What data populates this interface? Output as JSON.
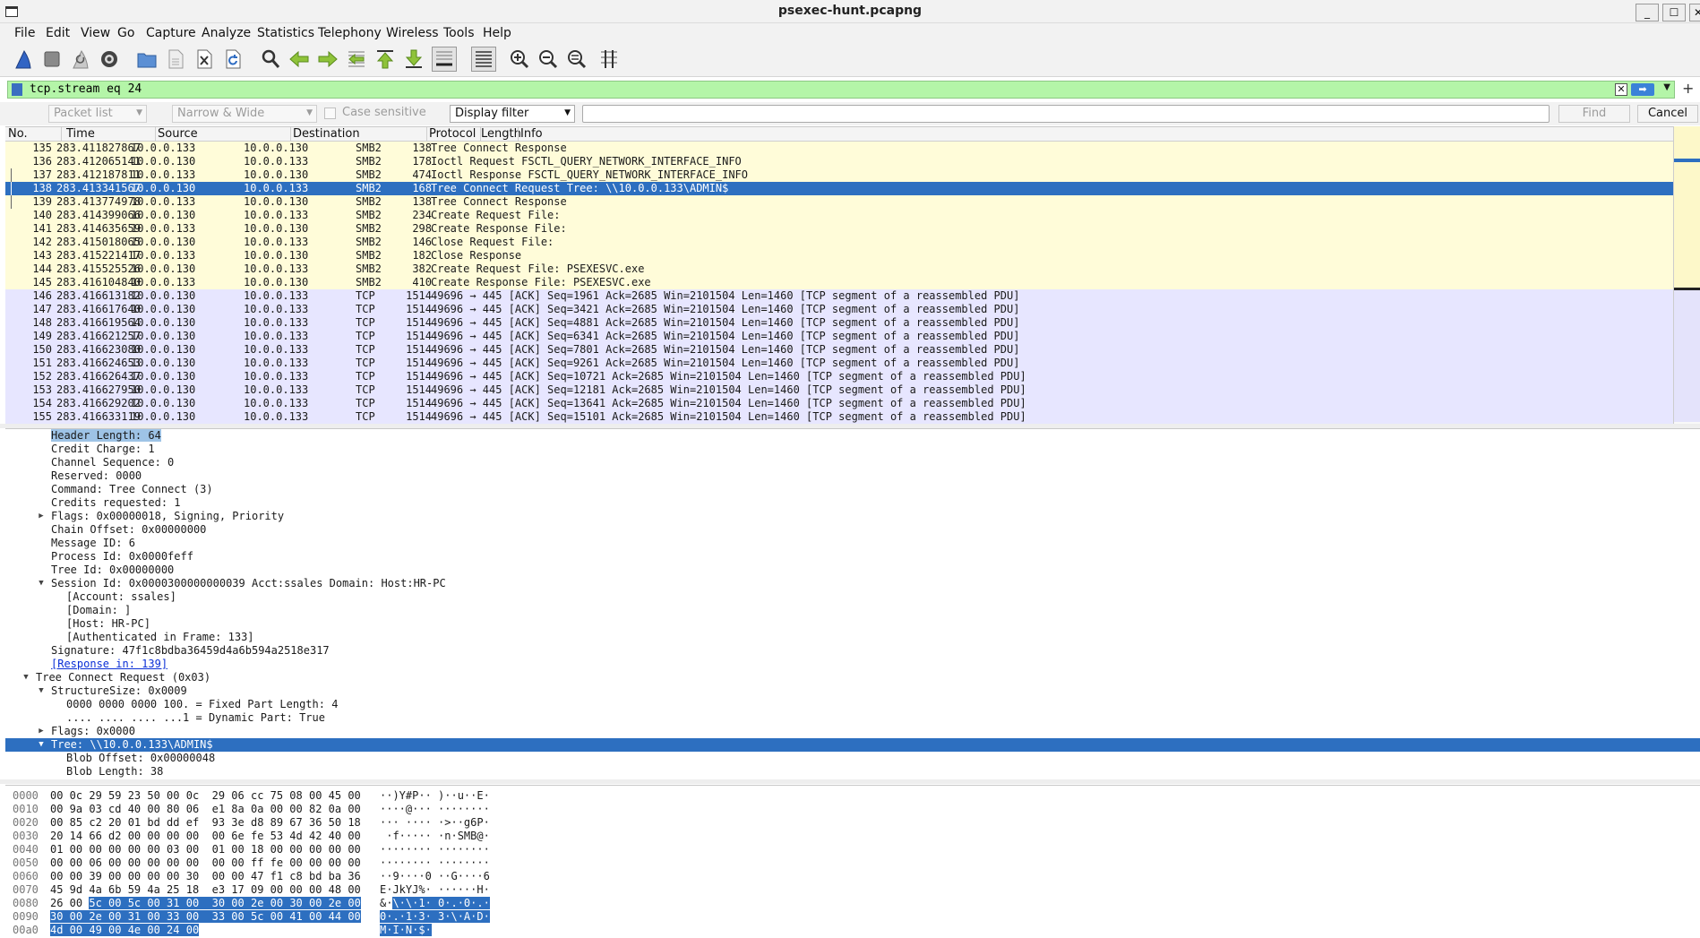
{
  "window": {
    "title": "psexec-hunt.pcapng"
  },
  "menu": [
    "File",
    "Edit",
    "View",
    "Go",
    "Capture",
    "Analyze",
    "Statistics",
    "Telephony",
    "Wireless",
    "Tools",
    "Help"
  ],
  "toolbar_icons": [
    "shark-fin-start-icon",
    "stop-square-icon",
    "restart-fin-icon",
    "capture-options-gear-icon",
    "open-folder-icon",
    "save-file-icon",
    "close-file-icon",
    "reload-icon",
    "find-packet-icon",
    "go-back-icon",
    "go-forward-icon",
    "go-to-packet-icon",
    "first-packet-icon",
    "last-packet-icon",
    "autoscroll-icon",
    "colorize-icon",
    "zoom-in-icon",
    "zoom-out-icon",
    "zoom-normal-icon",
    "resize-columns-icon"
  ],
  "filter": {
    "value": "tcp.stream eq 24",
    "color": "#b4f5a8"
  },
  "findbar": {
    "search_in": "Packet list",
    "char_width": "Narrow & Wide",
    "case_label": "Case sensitive",
    "search_type": "Display filter",
    "find_label": "Find",
    "cancel_label": "Cancel"
  },
  "packet_columns": [
    "No.",
    "Time",
    "Source",
    "Destination",
    "Protocol",
    "Length",
    "Info"
  ],
  "packets": [
    {
      "no": "135",
      "time": "283.411827867",
      "src": "10.0.0.133",
      "dst": "10.0.0.130",
      "proto": "SMB2",
      "len": "138",
      "info": "Tree Connect Response",
      "kind": "smb"
    },
    {
      "no": "136",
      "time": "283.412065141",
      "src": "10.0.0.130",
      "dst": "10.0.0.133",
      "proto": "SMB2",
      "len": "178",
      "info": "Ioctl Request FSCTL_QUERY_NETWORK_INTERFACE_INFO",
      "kind": "smb"
    },
    {
      "no": "137",
      "time": "283.412187811",
      "src": "10.0.0.133",
      "dst": "10.0.0.130",
      "proto": "SMB2",
      "len": "474",
      "info": "Ioctl Response FSCTL_QUERY_NETWORK_INTERFACE_INFO",
      "kind": "smb"
    },
    {
      "no": "138",
      "time": "283.413341567",
      "src": "10.0.0.130",
      "dst": "10.0.0.133",
      "proto": "SMB2",
      "len": "168",
      "info": "Tree Connect Request Tree: \\\\10.0.0.133\\ADMIN$",
      "kind": "sel"
    },
    {
      "no": "139",
      "time": "283.413774978",
      "src": "10.0.0.133",
      "dst": "10.0.0.130",
      "proto": "SMB2",
      "len": "138",
      "info": "Tree Connect Response",
      "kind": "smb"
    },
    {
      "no": "140",
      "time": "283.414399066",
      "src": "10.0.0.130",
      "dst": "10.0.0.133",
      "proto": "SMB2",
      "len": "234",
      "info": "Create Request File:",
      "kind": "smb"
    },
    {
      "no": "141",
      "time": "283.414635659",
      "src": "10.0.0.133",
      "dst": "10.0.0.130",
      "proto": "SMB2",
      "len": "298",
      "info": "Create Response File:",
      "kind": "smb"
    },
    {
      "no": "142",
      "time": "283.415018065",
      "src": "10.0.0.130",
      "dst": "10.0.0.133",
      "proto": "SMB2",
      "len": "146",
      "info": "Close Request File:",
      "kind": "smb"
    },
    {
      "no": "143",
      "time": "283.415221417",
      "src": "10.0.0.133",
      "dst": "10.0.0.130",
      "proto": "SMB2",
      "len": "182",
      "info": "Close Response",
      "kind": "smb"
    },
    {
      "no": "144",
      "time": "283.415525526",
      "src": "10.0.0.130",
      "dst": "10.0.0.133",
      "proto": "SMB2",
      "len": "382",
      "info": "Create Request File: PSEXESVC.exe",
      "kind": "smb"
    },
    {
      "no": "145",
      "time": "283.416104840",
      "src": "10.0.0.133",
      "dst": "10.0.0.130",
      "proto": "SMB2",
      "len": "410",
      "info": "Create Response File: PSEXESVC.exe",
      "kind": "smb"
    },
    {
      "no": "146",
      "time": "283.416613182",
      "src": "10.0.0.130",
      "dst": "10.0.0.133",
      "proto": "TCP",
      "len": "1514",
      "info": "49696 → 445 [ACK] Seq=1961 Ack=2685 Win=2101504 Len=1460 [TCP segment of a reassembled PDU]",
      "kind": "tcp"
    },
    {
      "no": "147",
      "time": "283.416617640",
      "src": "10.0.0.130",
      "dst": "10.0.0.133",
      "proto": "TCP",
      "len": "1514",
      "info": "49696 → 445 [ACK] Seq=3421 Ack=2685 Win=2101504 Len=1460 [TCP segment of a reassembled PDU]",
      "kind": "tcp"
    },
    {
      "no": "148",
      "time": "283.416619564",
      "src": "10.0.0.130",
      "dst": "10.0.0.133",
      "proto": "TCP",
      "len": "1514",
      "info": "49696 → 445 [ACK] Seq=4881 Ack=2685 Win=2101504 Len=1460 [TCP segment of a reassembled PDU]",
      "kind": "tcp"
    },
    {
      "no": "149",
      "time": "283.416621257",
      "src": "10.0.0.130",
      "dst": "10.0.0.133",
      "proto": "TCP",
      "len": "1514",
      "info": "49696 → 445 [ACK] Seq=6341 Ack=2685 Win=2101504 Len=1460 [TCP segment of a reassembled PDU]",
      "kind": "tcp"
    },
    {
      "no": "150",
      "time": "283.416623080",
      "src": "10.0.0.130",
      "dst": "10.0.0.133",
      "proto": "TCP",
      "len": "1514",
      "info": "49696 → 445 [ACK] Seq=7801 Ack=2685 Win=2101504 Len=1460 [TCP segment of a reassembled PDU]",
      "kind": "tcp"
    },
    {
      "no": "151",
      "time": "283.416624653",
      "src": "10.0.0.130",
      "dst": "10.0.0.133",
      "proto": "TCP",
      "len": "1514",
      "info": "49696 → 445 [ACK] Seq=9261 Ack=2685 Win=2101504 Len=1460 [TCP segment of a reassembled PDU]",
      "kind": "tcp"
    },
    {
      "no": "152",
      "time": "283.416626437",
      "src": "10.0.0.130",
      "dst": "10.0.0.133",
      "proto": "TCP",
      "len": "1514",
      "info": "49696 → 445 [ACK] Seq=10721 Ack=2685 Win=2101504 Len=1460 [TCP segment of a reassembled PDU]",
      "kind": "tcp"
    },
    {
      "no": "153",
      "time": "283.416627950",
      "src": "10.0.0.130",
      "dst": "10.0.0.133",
      "proto": "TCP",
      "len": "1514",
      "info": "49696 → 445 [ACK] Seq=12181 Ack=2685 Win=2101504 Len=1460 [TCP segment of a reassembled PDU]",
      "kind": "tcp"
    },
    {
      "no": "154",
      "time": "283.416629202",
      "src": "10.0.0.130",
      "dst": "10.0.0.133",
      "proto": "TCP",
      "len": "1514",
      "info": "49696 → 445 [ACK] Seq=13641 Ack=2685 Win=2101504 Len=1460 [TCP segment of a reassembled PDU]",
      "kind": "tcp"
    },
    {
      "no": "155",
      "time": "283.416633119",
      "src": "10.0.0.130",
      "dst": "10.0.0.133",
      "proto": "TCP",
      "len": "1514",
      "info": "49696 → 445 [ACK] Seq=15101 Ack=2685 Win=2101504 Len=1460 [TCP segment of a reassembled PDU]",
      "kind": "tcp"
    }
  ],
  "details": [
    {
      "lvl": 3,
      "tog": "",
      "text": "Header Length: 64",
      "style": "hl"
    },
    {
      "lvl": 3,
      "tog": "",
      "text": "Credit Charge: 1"
    },
    {
      "lvl": 3,
      "tog": "",
      "text": "Channel Sequence: 0"
    },
    {
      "lvl": 3,
      "tog": "",
      "text": "Reserved: 0000"
    },
    {
      "lvl": 3,
      "tog": "",
      "text": "Command: Tree Connect (3)"
    },
    {
      "lvl": 3,
      "tog": "",
      "text": "Credits requested: 1"
    },
    {
      "lvl": 3,
      "tog": "collapsed",
      "text": "Flags: 0x00000018, Signing, Priority"
    },
    {
      "lvl": 3,
      "tog": "",
      "text": "Chain Offset: 0x00000000"
    },
    {
      "lvl": 3,
      "tog": "",
      "text": "Message ID: 6"
    },
    {
      "lvl": 3,
      "tog": "",
      "text": "Process Id: 0x0000feff"
    },
    {
      "lvl": 3,
      "tog": "",
      "text": "Tree Id: 0x00000000"
    },
    {
      "lvl": 3,
      "tog": "expanded",
      "text": "Session Id: 0x0000300000000039 Acct:ssales Domain: Host:HR-PC"
    },
    {
      "lvl": 4,
      "tog": "",
      "text": "[Account: ssales]"
    },
    {
      "lvl": 4,
      "tog": "",
      "text": "[Domain: ]"
    },
    {
      "lvl": 4,
      "tog": "",
      "text": "[Host: HR-PC]"
    },
    {
      "lvl": 4,
      "tog": "",
      "text": "[Authenticated in Frame: 133]"
    },
    {
      "lvl": 3,
      "tog": "",
      "text": "Signature: 47f1c8bdba36459d4a6b594a2518e317"
    },
    {
      "lvl": 3,
      "tog": "",
      "text": "[Response in: 139]",
      "style": "link"
    },
    {
      "lvl": 2,
      "tog": "expanded",
      "text": "Tree Connect Request (0x03)"
    },
    {
      "lvl": 3,
      "tog": "expanded",
      "text": "StructureSize: 0x0009"
    },
    {
      "lvl": 4,
      "tog": "",
      "text": "0000 0000 0000 100. = Fixed Part Length: 4"
    },
    {
      "lvl": 4,
      "tog": "",
      "text": ".... .... .... ...1 = Dynamic Part: True"
    },
    {
      "lvl": 3,
      "tog": "collapsed",
      "text": "Flags: 0x0000"
    },
    {
      "lvl": 3,
      "tog": "expanded",
      "text": "Tree: \\\\10.0.0.133\\ADMIN$",
      "style": "sel"
    },
    {
      "lvl": 4,
      "tog": "",
      "text": "Blob Offset: 0x00000048"
    },
    {
      "lvl": 4,
      "tog": "",
      "text": "Blob Length: 38"
    }
  ],
  "bytes": [
    {
      "off": "0000",
      "hex": "00 0c 29 59 23 50 00 0c  29 06 cc 75 08 00 45 00",
      "asc": "··)Y#P·· )··u··E·",
      "hs": -1,
      "as": -1
    },
    {
      "off": "0010",
      "hex": "00 9a 03 cd 40 00 80 06  e1 8a 0a 00 00 82 0a 00",
      "asc": "····@··· ········",
      "hs": -1,
      "as": -1
    },
    {
      "off": "0020",
      "hex": "00 85 c2 20 01 bd dd ef  93 3e d8 89 67 36 50 18",
      "asc": "··· ···· ·>··g6P·",
      "hs": -1,
      "as": -1
    },
    {
      "off": "0030",
      "hex": "20 14 66 d2 00 00 00 00  00 6e fe 53 4d 42 40 00",
      "asc": " ·f····· ·n·SMB@·",
      "hs": -1,
      "as": -1
    },
    {
      "off": "0040",
      "hex": "01 00 00 00 00 00 03 00  01 00 18 00 00 00 00 00",
      "asc": "········ ········",
      "hs": -1,
      "as": -1
    },
    {
      "off": "0050",
      "hex": "00 00 06 00 00 00 00 00  00 00 ff fe 00 00 00 00",
      "asc": "········ ········",
      "hs": -1,
      "as": -1
    },
    {
      "off": "0060",
      "hex": "00 00 39 00 00 00 00 30  00 00 47 f1 c8 bd ba 36",
      "asc": "··9····0 ··G····6",
      "hs": -1,
      "as": -1
    },
    {
      "off": "0070",
      "hex": "45 9d 4a 6b 59 4a 25 18  e3 17 09 00 00 00 48 00",
      "asc": "E·JkYJ%· ······H·",
      "hs": -1,
      "as": -1
    },
    {
      "off": "0080",
      "hex": "26 00 5c 00 5c 00 31 00  30 00 2e 00 30 00 2e 00",
      "asc": "&·\\·\\·1· 0·.·0·.·",
      "hs": 6,
      "as": 2
    },
    {
      "off": "0090",
      "hex": "30 00 2e 00 31 00 33 00  33 00 5c 00 41 00 44 00",
      "asc": "0·.·1·3· 3·\\·A·D·",
      "hs": 0,
      "as": 0
    },
    {
      "off": "00a0",
      "hex": "4d 00 49 00 4e 00 24 00",
      "asc": "M·I·N·$·",
      "hs": 0,
      "as": 0
    }
  ]
}
